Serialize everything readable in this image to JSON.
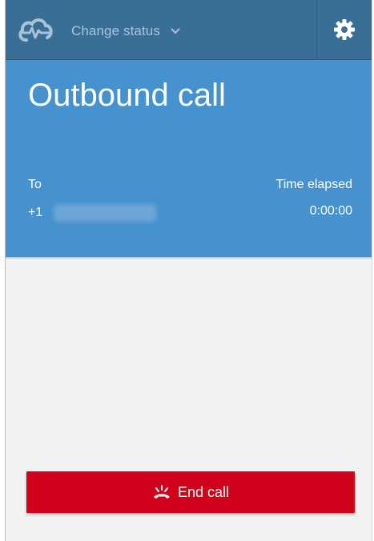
{
  "header": {
    "logo_icon": "cloud-pulse-icon",
    "status_label": "Change status",
    "status_chevron_icon": "chevron-down-icon",
    "settings_icon": "gear-icon"
  },
  "call": {
    "title": "Outbound call",
    "to_label": "To",
    "to_number_prefix": "+1",
    "time_label": "Time elapsed",
    "time_value": "0:00:00"
  },
  "actions": {
    "end_call_label": "End call",
    "end_call_icon": "hang-up-icon",
    "end_call_color": "#d0021b"
  },
  "colors": {
    "topbar": "#3a6f95",
    "call_panel": "#4592cf",
    "body": "#f2f2f2"
  }
}
